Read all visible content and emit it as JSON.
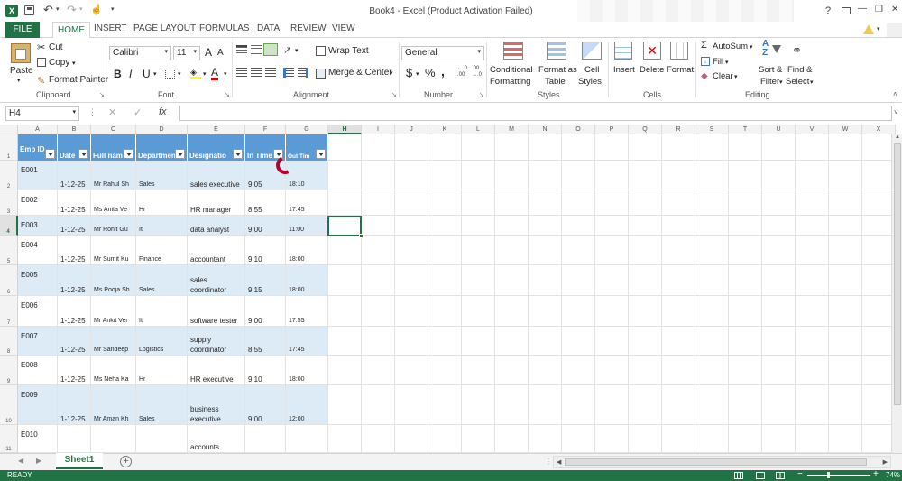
{
  "window": {
    "title": "Book4 - Excel (Product Activation Failed)",
    "help": "?",
    "minimize": "—",
    "restore": "❐",
    "close": "✕"
  },
  "ribbon_tabs": [
    {
      "label": "FILE"
    },
    {
      "label": "HOME"
    },
    {
      "label": "INSERT"
    },
    {
      "label": "PAGE LAYOUT"
    },
    {
      "label": "FORMULAS"
    },
    {
      "label": "DATA"
    },
    {
      "label": "REVIEW"
    },
    {
      "label": "VIEW"
    }
  ],
  "clipboard": {
    "paste": "Paste",
    "cut": "Cut",
    "copy": "Copy",
    "format_painter": "Format Painter",
    "group": "Clipboard"
  },
  "font": {
    "name": "Calibri",
    "size": "11",
    "grow": "A",
    "shrink": "A",
    "bold": "B",
    "italic": "I",
    "underline": "U",
    "font_color_letter": "A",
    "group": "Font"
  },
  "alignment": {
    "wrap": "Wrap Text",
    "merge": "Merge & Center",
    "group": "Alignment"
  },
  "number": {
    "format": "General",
    "currency": "$",
    "percent": "%",
    "comma": ",",
    "group": "Number"
  },
  "styles": {
    "conditional_1": "Conditional",
    "conditional_2": "Formatting",
    "format_table_1": "Format as",
    "format_table_2": "Table",
    "cell_styles_1": "Cell",
    "cell_styles_2": "Styles",
    "group": "Styles"
  },
  "cells": {
    "insert": "Insert",
    "delete": "Delete",
    "format": "Format",
    "group": "Cells"
  },
  "editing": {
    "autosum": "AutoSum",
    "fill": "Fill",
    "clear": "Clear",
    "sort_1": "Sort &",
    "sort_2": "Filter",
    "find_1": "Find &",
    "find_2": "Select",
    "group": "Editing"
  },
  "formula_bar": {
    "name_box": "H4",
    "fx": "fx",
    "value": ""
  },
  "columns": [
    "A",
    "B",
    "C",
    "D",
    "E",
    "F",
    "G",
    "H",
    "I",
    "J",
    "K",
    "L",
    "M",
    "N",
    "O",
    "P",
    "Q",
    "R",
    "S",
    "T",
    "U",
    "V",
    "W",
    "X"
  ],
  "header_row": {
    "row_number": "1",
    "cells": [
      "Emp ID",
      "Date",
      "Full nam",
      "Departmen",
      "Designatio",
      "In Time",
      "Out Tim"
    ]
  },
  "rows": [
    {
      "num": "2",
      "emp": "E001",
      "date": "1-12-25",
      "name": "Mr  Rahul  Sh",
      "dept": "Sales",
      "desig": [
        "sales executive"
      ],
      "in": "9:05",
      "out": "18:10"
    },
    {
      "num": "3",
      "emp": "E002",
      "date": "1-12-25",
      "name": "Ms  Anita  Ve",
      "dept": "Hr",
      "desig": [
        "HR manager"
      ],
      "in": "8:55",
      "out": "17:45"
    },
    {
      "num": "4",
      "emp": "E003",
      "date": "1-12-25",
      "name": "Mr  Rohit  Gu",
      "dept": "It",
      "desig": [
        "data analyst"
      ],
      "in": "9:00",
      "out": "11:00"
    },
    {
      "num": "5",
      "emp": "E004",
      "date": "1-12-25",
      "name": "Mr  Sumit  Ku",
      "dept": "Finance",
      "desig": [
        "accountant"
      ],
      "in": "9:10",
      "out": "18:00"
    },
    {
      "num": "6",
      "emp": "E005",
      "date": "1-12-25",
      "name": "Ms  Pooja  Sh",
      "dept": "Sales",
      "desig": [
        "sales",
        "coordinator"
      ],
      "in": "9:15",
      "out": "18:00"
    },
    {
      "num": "7",
      "emp": "E006",
      "date": "1-12-25",
      "name": "Mr  Ankit  Ver",
      "dept": "It",
      "desig": [
        "software tester"
      ],
      "in": "9:00",
      "out": "17:55"
    },
    {
      "num": "8",
      "emp": "E007",
      "date": "1-12-25",
      "name": "Mr  Sandeep",
      "dept": "Logistics",
      "desig": [
        "supply",
        "coordinator"
      ],
      "in": "8:55",
      "out": "17:45"
    },
    {
      "num": "9",
      "emp": "E008",
      "date": "1-12-25",
      "name": "Ms  Neha  Ka",
      "dept": "Hr",
      "desig": [
        "HR executive"
      ],
      "in": "9:10",
      "out": "18:00"
    },
    {
      "num": "10",
      "emp": "E009",
      "date": "1-12-25",
      "name": "Mr  Aman  Kh",
      "dept": "Sales",
      "desig": [
        "business",
        "executive"
      ],
      "in": "9:00",
      "out": "12:00"
    },
    {
      "num": "11",
      "emp": "E010",
      "date": "",
      "name": "",
      "dept": "",
      "desig": [
        "accounts"
      ],
      "in": "",
      "out": ""
    }
  ],
  "sheet_tab": "Sheet1",
  "status": {
    "ready": "READY",
    "zoom": "74%"
  },
  "colors": {
    "excel_green": "#217346",
    "header_blue": "#5b9bd5",
    "band_blue": "#ddebf7"
  }
}
